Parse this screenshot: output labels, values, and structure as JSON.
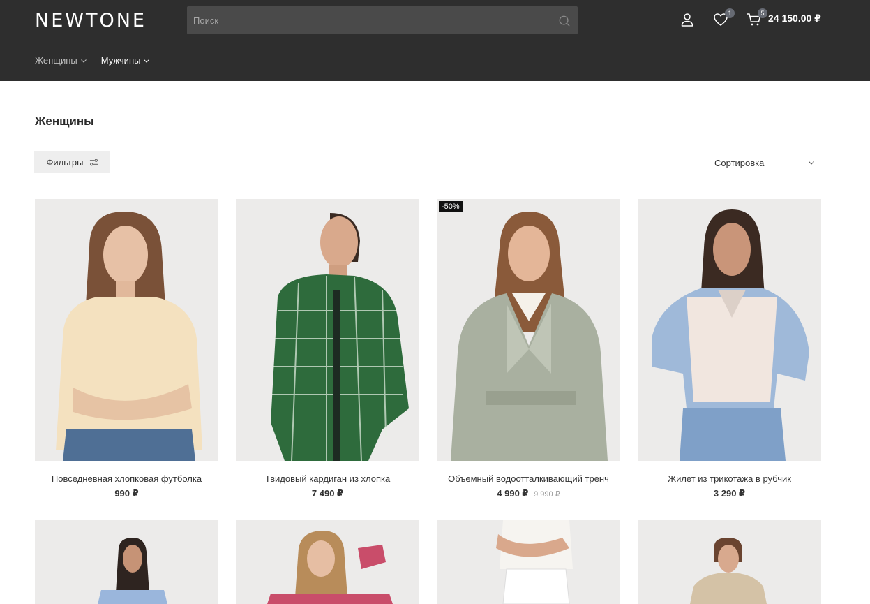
{
  "header": {
    "logo": "NEWTONE",
    "search_placeholder": "Поиск",
    "wishlist_count": "1",
    "cart_count": "5",
    "cart_total": "24 150.00 ₽"
  },
  "nav": [
    {
      "label": "Женщины"
    },
    {
      "label": "Мужчины"
    }
  ],
  "main": {
    "title": "Женщины",
    "filters_label": "Фильтры",
    "sort_label": "Сортировка"
  },
  "products": [
    {
      "name": "Повседневная хлопковая футболка",
      "price": "990 ₽",
      "old_price": "",
      "badge": ""
    },
    {
      "name": "Твидовый кардиган из хлопка",
      "price": "7 490 ₽",
      "old_price": "",
      "badge": ""
    },
    {
      "name": "Объемный водоотталкивающий тренч",
      "price": "4 990 ₽",
      "old_price": "9 990 ₽",
      "badge": "-50%"
    },
    {
      "name": "Жилет из трикотажа в рубчик",
      "price": "3 290 ₽",
      "old_price": "",
      "badge": ""
    }
  ],
  "colors": {
    "header_bg": "#2e2e2e",
    "search_bg": "#4a4a4a",
    "badge_bg": "#666a73",
    "discount_bg": "#111111"
  },
  "icons": [
    "search-icon",
    "user-icon",
    "heart-icon",
    "cart-icon",
    "chevron-down-icon",
    "filter-icon"
  ]
}
